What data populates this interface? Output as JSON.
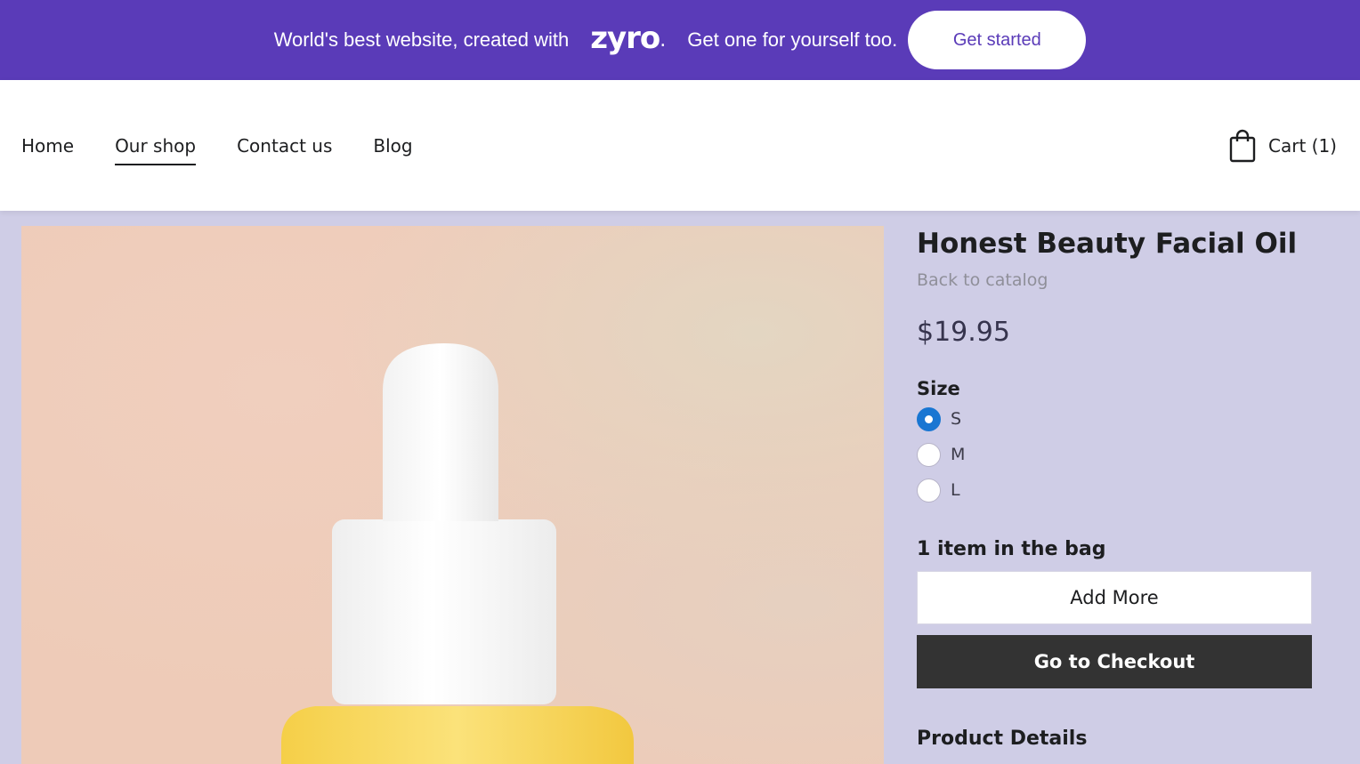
{
  "promo": {
    "text_before": "World's best website, created with",
    "brand": "zyro",
    "brand_dot": ".",
    "text_after": "Get one for yourself too.",
    "cta_label": "Get started",
    "background": "#5a3bb8"
  },
  "nav": {
    "items": [
      {
        "label": "Home",
        "active": false
      },
      {
        "label": "Our shop",
        "active": true
      },
      {
        "label": "Contact us",
        "active": false
      },
      {
        "label": "Blog",
        "active": false
      }
    ],
    "cart_icon": "shopping-bag-icon",
    "cart_label": "Cart (1)"
  },
  "product": {
    "image": "facial-oil-dropper-bottle",
    "title": "Honest Beauty Facial Oil",
    "back_link": "Back to catalog",
    "price": "$19.95",
    "size_label": "Size",
    "sizes": [
      {
        "label": "S",
        "selected": true
      },
      {
        "label": "M",
        "selected": false
      },
      {
        "label": "L",
        "selected": false
      }
    ],
    "bag_text": "1 item in the bag",
    "add_more_label": "Add More",
    "checkout_label": "Go to Checkout",
    "details_heading": "Product Details"
  },
  "colors": {
    "page_background": "#cfcde6",
    "accent": "#1976d2",
    "checkout_button": "#333333"
  }
}
